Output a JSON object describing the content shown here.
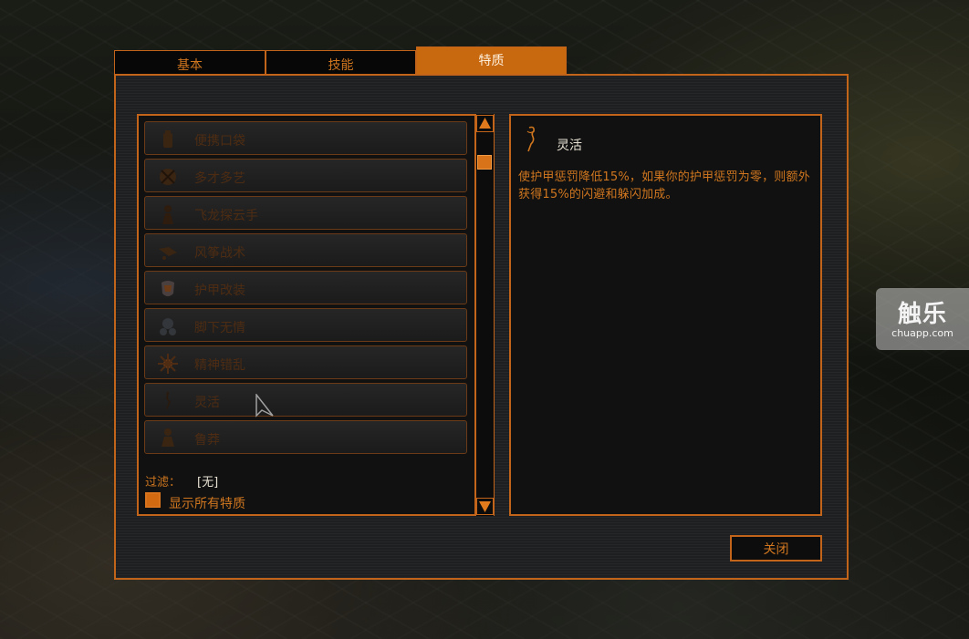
{
  "tabs": [
    {
      "label": "基本"
    },
    {
      "label": "技能"
    },
    {
      "label": "特质",
      "active": true
    }
  ],
  "traits": [
    {
      "label": "便携口袋",
      "icon": "pocket-icon"
    },
    {
      "label": "多才多艺",
      "icon": "versatile-icon"
    },
    {
      "label": "飞龙探云手",
      "icon": "pickpocket-icon"
    },
    {
      "label": "风筝战术",
      "icon": "kite-tactics-icon"
    },
    {
      "label": "护甲改装",
      "icon": "armor-mod-icon"
    },
    {
      "label": "脚下无情",
      "icon": "stomp-icon"
    },
    {
      "label": "精神错乱",
      "icon": "insanity-icon"
    },
    {
      "label": "灵活",
      "icon": "agile-icon"
    },
    {
      "label": "鲁莽",
      "icon": "reckless-icon"
    }
  ],
  "filter": {
    "label": "过滤：",
    "value": "[无]"
  },
  "show_all": {
    "label": "显示所有特质",
    "checked": true
  },
  "detail": {
    "title": "灵活",
    "icon": "agile-icon",
    "description": "使护甲惩罚降低15%，如果你的护甲惩罚为零，则额外获得15%的闪避和躲闪加成。"
  },
  "buttons": {
    "close": "关闭"
  },
  "watermark": {
    "big": "触乐",
    "small": "chuapp.com"
  },
  "colors": {
    "accent": "#c2651a",
    "accent_fill": "#c8680f",
    "panel": "#101110"
  }
}
